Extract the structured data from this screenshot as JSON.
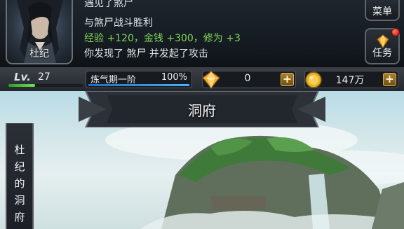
{
  "player": {
    "name": "杜纪",
    "level_label": "Lv.",
    "level": "27",
    "level_progress": 0.36
  },
  "log": [
    "遇见了煞尸",
    "与煞尸战斗胜利",
    "经验 +120，金钱 +300，修为 +3",
    "你发现了 煞尸 并发起了攻击"
  ],
  "buttons": {
    "menu": "菜单",
    "task": "任务"
  },
  "cultivation": {
    "stage": "炼气期一阶",
    "percent": "100%",
    "progress": 1.0
  },
  "currency": {
    "ingot": "0",
    "coin": "147万",
    "plus": "+"
  },
  "scene": {
    "title": "洞府",
    "banner": [
      "杜",
      "纪",
      "的",
      "洞",
      "府"
    ]
  },
  "colors": {
    "log_highlight": "#7ed85a",
    "exp_bar": "#6ee05a",
    "cultivation_bar": "#47b1ff",
    "gold": "#e8b02a",
    "notification": "#d82a1d"
  }
}
